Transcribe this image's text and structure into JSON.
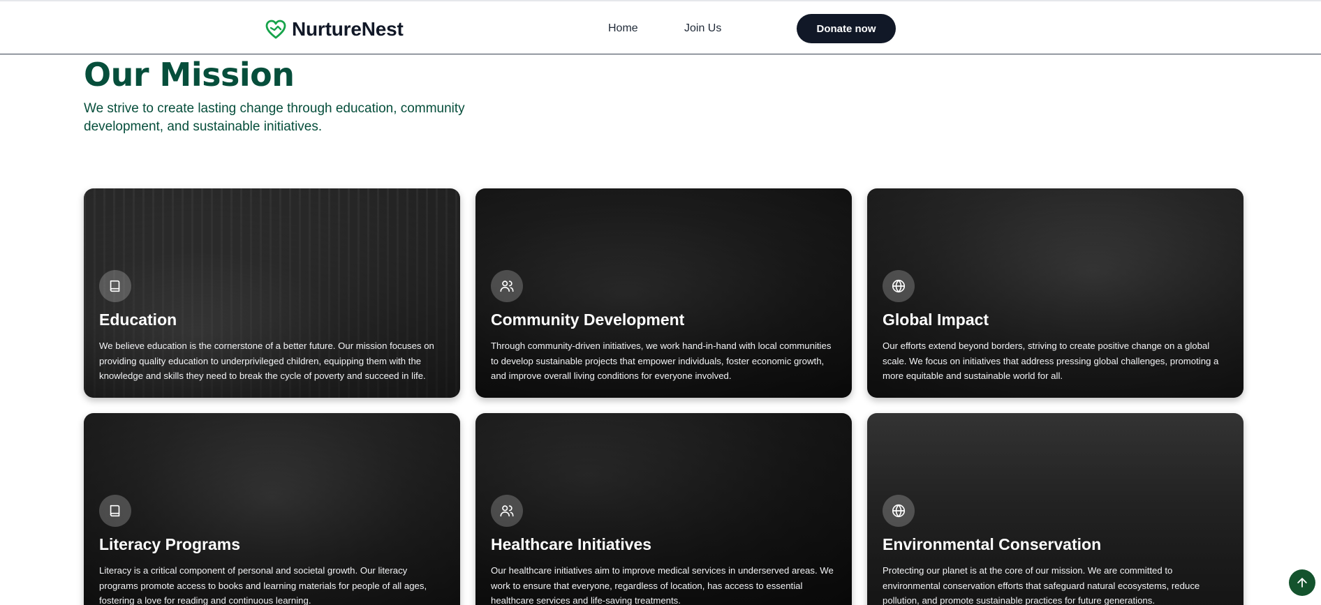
{
  "header": {
    "brand": "NurtureNest",
    "nav": [
      {
        "label": "Home"
      },
      {
        "label": "Join Us"
      }
    ],
    "donate_label": "Donate now"
  },
  "mission": {
    "title": "Our Mission",
    "subtitle": "We strive to create lasting change through education, community development, and sustainable initiatives."
  },
  "cards": [
    {
      "icon": "book-icon",
      "title": "Education",
      "text": "We believe education is the cornerstone of a better future. Our mission focuses on providing quality education to underprivileged children, equipping them with the knowledge and skills they need to break the cycle of poverty and succeed in life."
    },
    {
      "icon": "users-icon",
      "title": "Community Development",
      "text": "Through community-driven initiatives, we work hand-in-hand with local communities to develop sustainable projects that empower individuals, foster economic growth, and improve overall living conditions for everyone involved."
    },
    {
      "icon": "globe-icon",
      "title": "Global Impact",
      "text": "Our efforts extend beyond borders, striving to create positive change on a global scale. We focus on initiatives that address pressing global challenges, promoting a more equitable and sustainable world for all."
    },
    {
      "icon": "book-icon",
      "title": "Literacy Programs",
      "text": "Literacy is a critical component of personal and societal growth. Our literacy programs promote access to books and learning materials for people of all ages, fostering a love for reading and continuous learning."
    },
    {
      "icon": "users-icon",
      "title": "Healthcare Initiatives",
      "text": "Our healthcare initiatives aim to improve medical services in underserved areas. We work to ensure that everyone, regardless of location, has access to essential healthcare services and life-saving treatments."
    },
    {
      "icon": "globe-icon",
      "title": "Environmental Conservation",
      "text": "Protecting our planet is at the core of our mission. We are committed to environmental conservation efforts that safeguard natural ecosystems, reduce pollution, and promote sustainable practices for future generations."
    }
  ],
  "colors": {
    "brand_green": "#16a34a",
    "heading_green": "#064e3b",
    "donate_bg": "#111827",
    "scroll_top_bg": "#14532d"
  },
  "scroll_top": {
    "icon": "arrow-up-icon"
  }
}
